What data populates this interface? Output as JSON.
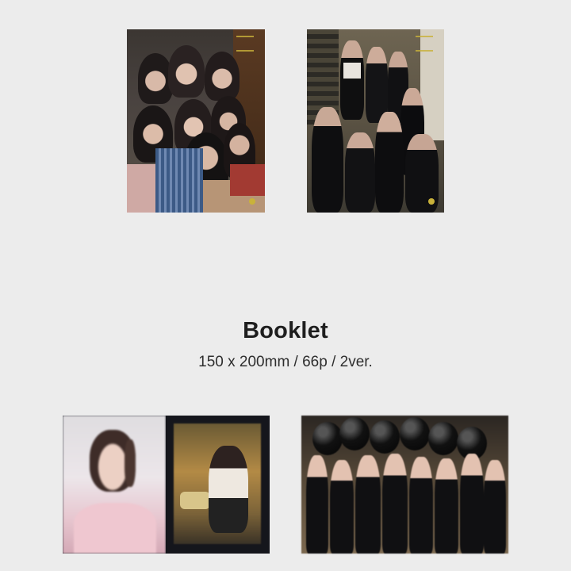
{
  "booklet": {
    "title": "Booklet",
    "spec": "150 x 200mm / 66p / 2ver."
  },
  "images": [
    {
      "id": "poster-1",
      "description": "group photo poster version 1 (pastel outfits)"
    },
    {
      "id": "poster-2",
      "description": "group photo poster version 2 (black outfits)"
    },
    {
      "id": "spread-1",
      "description": "booklet inner spread, portrait pages"
    },
    {
      "id": "spread-2",
      "description": "booklet inner spread, group with black balloons"
    }
  ],
  "colors": {
    "background": "#ececec",
    "title_text": "#1e1e1e",
    "spec_text": "#2e2e2e"
  }
}
